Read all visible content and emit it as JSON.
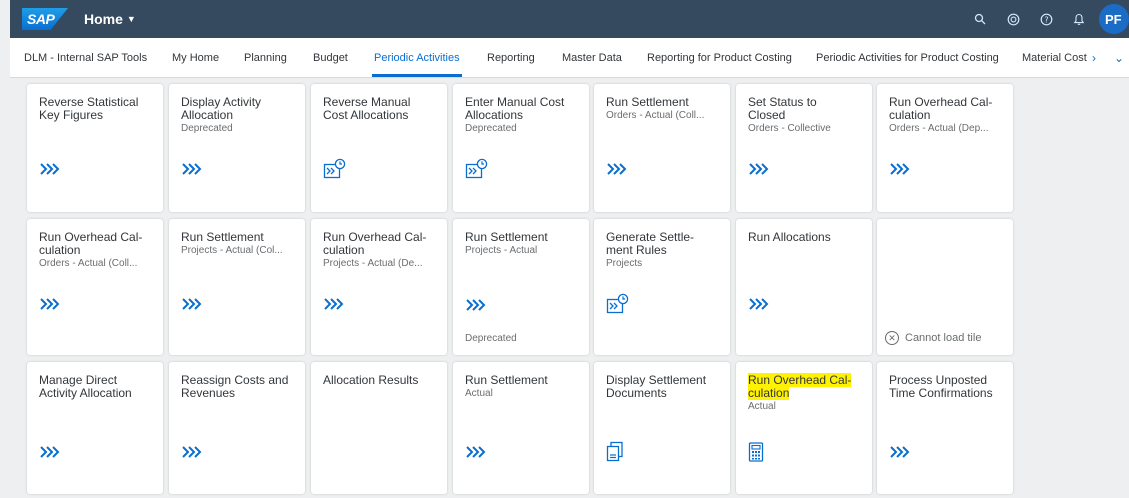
{
  "colors": {
    "shell_bg": "#354a5f",
    "accent": "#0a6ed1",
    "page_bg": "#edeff0",
    "highlight": "#fff200"
  },
  "shell": {
    "logo": "SAP",
    "home_label": "Home",
    "avatar_initials": "PF",
    "icons": [
      "search-icon",
      "copilot-icon",
      "help-icon",
      "notifications-icon"
    ]
  },
  "tabs": [
    {
      "label": "DLM - Internal SAP Tools"
    },
    {
      "label": "My Home"
    },
    {
      "label": "Planning"
    },
    {
      "label": "Budget"
    },
    {
      "label": "Periodic Activities",
      "active": true
    },
    {
      "label": "Reporting"
    },
    {
      "label": "Master Data"
    },
    {
      "label": "Reporting for Product Costing"
    },
    {
      "label": "Periodic Activities for Product Costing"
    },
    {
      "label": "Material Cost"
    }
  ],
  "tiles": [
    {
      "title": "Reverse Statistical\nKey Figures",
      "subtitle": "",
      "icon": "chevrons-icon"
    },
    {
      "title": "Display Activity\nAllocation",
      "subtitle": "Deprecated",
      "icon": "chevrons-icon"
    },
    {
      "title": "Reverse Manual\nCost Allocations",
      "subtitle": "",
      "icon": "scheduled-job-icon"
    },
    {
      "title": "Enter Manual Cost\nAllocations",
      "subtitle": "Deprecated",
      "icon": "scheduled-job-icon"
    },
    {
      "title": "Run Settlement",
      "subtitle": "Orders - Actual (Coll...",
      "icon": "chevrons-icon"
    },
    {
      "title": "Set Status to\nClosed",
      "subtitle": "Orders - Collective",
      "icon": "chevrons-icon"
    },
    {
      "title": "Run Overhead Cal-\nculation",
      "subtitle": "Orders - Actual (Dep...",
      "icon": "chevrons-icon"
    },
    {
      "title": "Run Overhead Cal-\nculation",
      "subtitle": "Orders - Actual (Coll...",
      "icon": "chevrons-icon"
    },
    {
      "title": "Run Settlement",
      "subtitle": "Projects - Actual (Col...",
      "icon": "chevrons-icon"
    },
    {
      "title": "Run Overhead Cal-\nculation",
      "subtitle": "Projects - Actual (De...",
      "icon": "chevrons-icon"
    },
    {
      "title": "Run Settlement",
      "subtitle": "Projects - Actual",
      "icon": "chevrons-icon",
      "footer": "Deprecated"
    },
    {
      "title": "Generate Settle-\nment Rules",
      "subtitle": "Projects",
      "icon": "scheduled-job-icon"
    },
    {
      "title": "Run Allocations",
      "subtitle": "",
      "icon": "chevrons-icon"
    },
    {
      "title": "",
      "subtitle": "",
      "icon": "",
      "error": "Cannot load tile"
    },
    {
      "title": "Manage Direct\nActivity Allocation",
      "subtitle": "",
      "icon": "chevrons-icon"
    },
    {
      "title": "Reassign Costs and\nRevenues",
      "subtitle": "",
      "icon": "chevrons-icon"
    },
    {
      "title": "Allocation Results",
      "subtitle": "",
      "icon": ""
    },
    {
      "title": "Run Settlement",
      "subtitle": "Actual",
      "icon": "chevrons-icon"
    },
    {
      "title": "Display Settlement\nDocuments",
      "subtitle": "",
      "icon": "documents-icon"
    },
    {
      "title": "Run Overhead Cal-\nculation",
      "subtitle": "Actual",
      "icon": "calculator-icon",
      "highlighted": true
    },
    {
      "title": "Process Unposted\nTime Confirmations",
      "subtitle": "",
      "icon": "chevrons-icon"
    }
  ]
}
